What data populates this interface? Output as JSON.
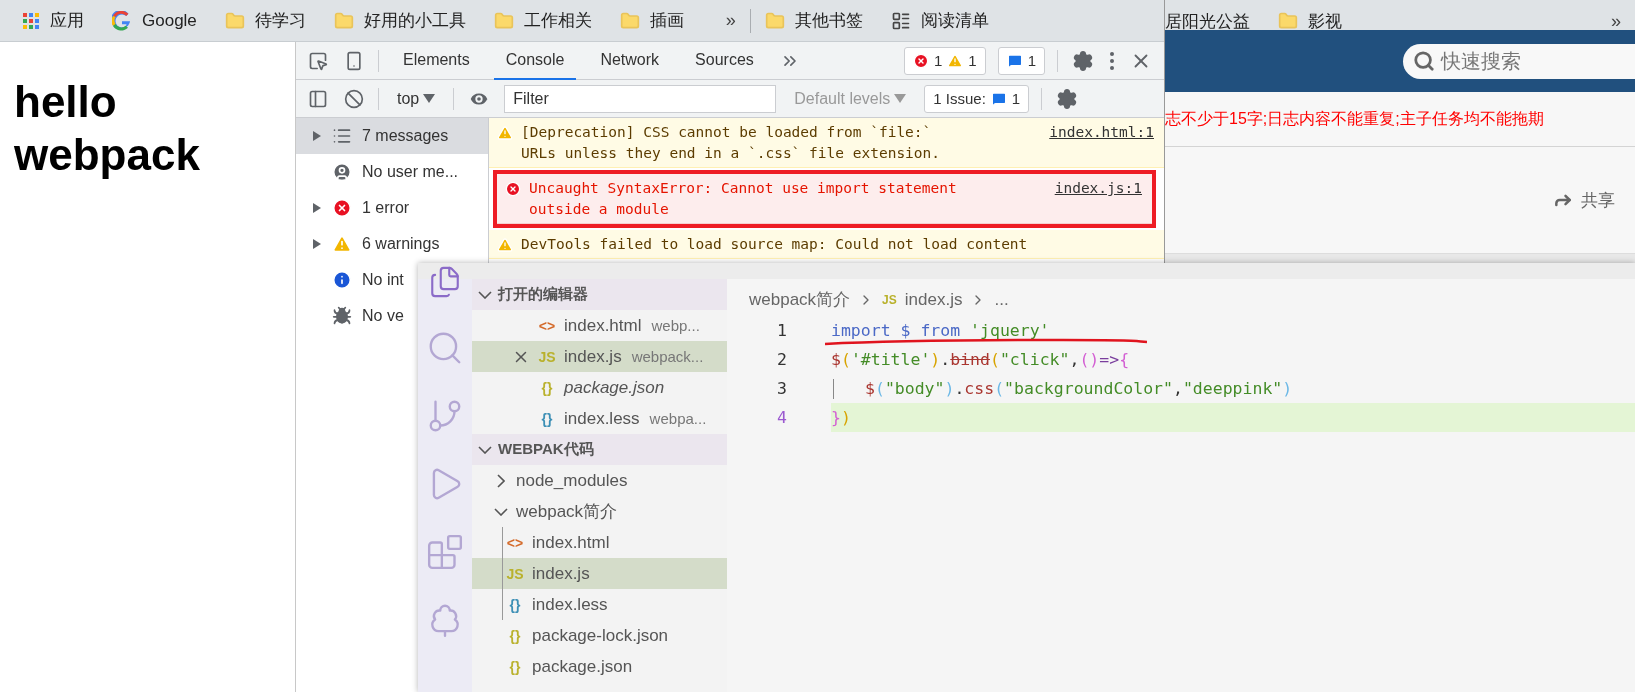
{
  "browser": {
    "bookmarks": [
      {
        "kind": "apps",
        "label": "应用"
      },
      {
        "kind": "google",
        "label": "Google"
      },
      {
        "kind": "folder",
        "label": "待学习"
      },
      {
        "kind": "folder",
        "label": "好用的小工具"
      },
      {
        "kind": "folder",
        "label": "工作相关"
      },
      {
        "kind": "folder",
        "label": "插画"
      }
    ],
    "bookmarks_more": "»",
    "other_bookmarks": [
      {
        "kind": "folder",
        "label": "其他书签"
      },
      {
        "kind": "reading",
        "label": "阅读清单"
      }
    ],
    "page": {
      "heading": "hello webpack"
    }
  },
  "devtools": {
    "tabs": [
      {
        "label": "Elements",
        "selected": false
      },
      {
        "label": "Console",
        "selected": true
      },
      {
        "label": "Network",
        "selected": false
      },
      {
        "label": "Sources",
        "selected": false
      }
    ],
    "error_count": "1",
    "warning_count": "1",
    "message_count": "1",
    "context": "top",
    "filter_placeholder": "Filter",
    "levels": "Default levels",
    "issues_label": "1 Issue:",
    "issues_count": "1",
    "sidebar": [
      {
        "kind": "messages",
        "label": "7 messages",
        "selected": true,
        "expandable": true
      },
      {
        "kind": "user",
        "label": "No user me...",
        "selected": false,
        "expandable": false
      },
      {
        "kind": "error",
        "label": "1 error",
        "selected": false,
        "expandable": true
      },
      {
        "kind": "warning",
        "label": "6 warnings",
        "selected": false,
        "expandable": true
      },
      {
        "kind": "info",
        "label": "No int",
        "selected": false,
        "expandable": false
      },
      {
        "kind": "verbose",
        "label": "No ve",
        "selected": false,
        "expandable": false
      }
    ],
    "messages": [
      {
        "kind": "warning",
        "lines": [
          "[Deprecation] CSS cannot be loaded from `file:`",
          "URLs unless they end in a `.css` file extension."
        ],
        "source": "index.html:1"
      },
      {
        "kind": "error",
        "lines": [
          "Uncaught SyntaxError: Cannot use import statement",
          "outside a module"
        ],
        "source": "index.js:1",
        "annotated": true
      },
      {
        "kind": "warning",
        "lines": [
          "DevTools failed to load source map: Could not load content"
        ]
      }
    ]
  },
  "other_browser": {
    "bookmarks": [
      {
        "kind": "plain",
        "label": "居阳光公益"
      },
      {
        "kind": "folder",
        "label": "影视"
      }
    ],
    "bookmarks_more": "»",
    "search_placeholder": "快速搜索",
    "notice": "志不少于15字;日志内容不能重复;主子任务均不能拖期",
    "share": "共享"
  },
  "editor": {
    "explorer": [
      {
        "label": "打开的编辑器",
        "expanded": true,
        "children": [
          {
            "icon": "<>",
            "color": "#d46a2a",
            "name": "index.html",
            "detail": "webp...",
            "selected": false,
            "preview": false
          },
          {
            "icon": "JS",
            "color": "#b9b12c",
            "name": "index.js",
            "detail": "webpack...",
            "selected": true,
            "preview": false
          },
          {
            "icon": "{}",
            "color": "#b9b12c",
            "name": "package.json",
            "selected": false,
            "preview": true
          },
          {
            "icon": "{}",
            "color": "#3c8fb5",
            "name": "index.less",
            "detail": "webpa...",
            "selected": false,
            "preview": false
          }
        ]
      },
      {
        "label": "WEBPAK代码",
        "expanded": true,
        "children": [
          {
            "name": "node_modules",
            "expanded": false
          },
          {
            "name": "webpack简介",
            "expanded": true,
            "children": [
              {
                "icon": "<>",
                "color": "#d46a2a",
                "name": "index.html",
                "selected": false
              },
              {
                "icon": "JS",
                "color": "#b9b12c",
                "name": "index.js",
                "selected": true
              },
              {
                "icon": "{}",
                "color": "#3c8fb5",
                "name": "index.less",
                "selected": false
              }
            ]
          },
          {
            "icon": "{}",
            "color": "#b9b12c",
            "name": "package-lock.json",
            "selected": false
          },
          {
            "icon": "{}",
            "color": "#b9b12c",
            "name": "package.json",
            "selected": false
          }
        ]
      }
    ],
    "breadcrumb": [
      {
        "label": "webpack简介"
      },
      {
        "icon": "JS",
        "label": "index.js"
      },
      {
        "label": "..."
      }
    ],
    "code": [
      {
        "number": "1",
        "highlighted": false,
        "indent": false,
        "tokens": [
          {
            "kind": "keyword",
            "text": "import $ from "
          },
          {
            "kind": "string",
            "text": "'jquery'"
          }
        ]
      },
      {
        "number": "2",
        "highlighted": false,
        "indent": false,
        "tokens": [
          {
            "kind": "func",
            "text": "$"
          },
          {
            "kind": "bracket1",
            "text": "("
          },
          {
            "kind": "string",
            "text": "'#title'"
          },
          {
            "kind": "bracket1",
            "text": ")"
          },
          {
            "kind": "punct",
            "text": "."
          },
          {
            "kind": "deprecated",
            "text": "bind"
          },
          {
            "kind": "bracket1",
            "text": "("
          },
          {
            "kind": "string",
            "text": "\"click\""
          },
          {
            "kind": "punct",
            "text": ","
          },
          {
            "kind": "bracket2",
            "text": "()"
          },
          {
            "kind": "operator",
            "text": "=>"
          },
          {
            "kind": "bracket2",
            "text": "{"
          }
        ]
      },
      {
        "number": "3",
        "highlighted": false,
        "indent": true,
        "tokens": [
          {
            "kind": "func",
            "text": "$"
          },
          {
            "kind": "bracket3",
            "text": "("
          },
          {
            "kind": "string",
            "text": "\"body\""
          },
          {
            "kind": "bracket3",
            "text": ")"
          },
          {
            "kind": "punct",
            "text": "."
          },
          {
            "kind": "func",
            "text": "css"
          },
          {
            "kind": "bracket3",
            "text": "("
          },
          {
            "kind": "string",
            "text": "\"backgroundColor\""
          },
          {
            "kind": "punct",
            "text": ","
          },
          {
            "kind": "string",
            "text": "\"deeppink\""
          },
          {
            "kind": "bracket3",
            "text": ")"
          }
        ]
      },
      {
        "number": "4",
        "highlighted": true,
        "indent": false,
        "tokens": [
          {
            "kind": "bracket2",
            "text": "}"
          },
          {
            "kind": "bracket1",
            "text": ")"
          }
        ]
      }
    ]
  }
}
